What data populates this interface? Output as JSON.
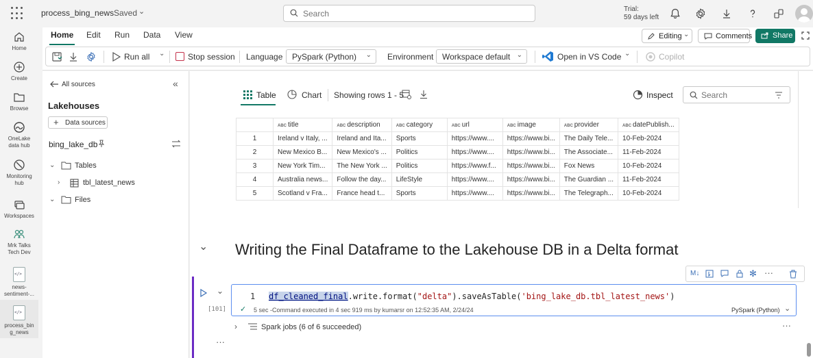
{
  "topbar": {
    "notebook_name": "process_bing_news",
    "save_state": "Saved",
    "search_placeholder": "Search",
    "trial_line1": "Trial:",
    "trial_line2": "59 days left"
  },
  "leftrail": {
    "items": [
      {
        "label": "Home",
        "icon": "home-icon"
      },
      {
        "label": "Create",
        "icon": "plus-circle-icon"
      },
      {
        "label": "Browse",
        "icon": "folder-icon"
      },
      {
        "label1": "OneLake",
        "label2": "data hub",
        "icon": "onelake-icon"
      },
      {
        "label1": "Monitoring",
        "label2": "hub",
        "icon": "monitor-icon"
      },
      {
        "label": "Workspaces",
        "icon": "workspaces-icon"
      },
      {
        "label1": "Mrk Talks",
        "label2": "Tech Dev",
        "icon": "workspace-people-icon"
      },
      {
        "label1": "news-",
        "label2": "sentiment-...",
        "icon": "notebook-icon"
      },
      {
        "label1": "process_bin",
        "label2": "g_news",
        "icon": "notebook-icon"
      }
    ]
  },
  "ribbon": {
    "tabs": [
      "Home",
      "Edit",
      "Run",
      "Data",
      "View"
    ],
    "editing": "Editing",
    "comments": "Comments",
    "share": "Share",
    "run_all": "Run all",
    "stop_session": "Stop session",
    "language_label": "Language",
    "language_value": "PySpark (Python)",
    "environment_label": "Environment",
    "environment_value": "Workspace default",
    "open_vscode": "Open in VS Code",
    "copilot": "Copilot"
  },
  "explorer": {
    "back_label": "All sources",
    "section_title": "Lakehouses",
    "data_sources_btn": "Data sources",
    "lakehouse_name": "bing_lake_db",
    "tables_label": "Tables",
    "table_item": "tbl_latest_news",
    "files_label": "Files"
  },
  "output": {
    "table_tab": "Table",
    "chart_tab": "Chart",
    "rows_info": "Showing rows 1 - 5",
    "inspect": "Inspect",
    "search_placeholder": "Search",
    "columns": [
      "title",
      "description",
      "category",
      "url",
      "image",
      "provider",
      "datePublish..."
    ],
    "rows": [
      [
        "1",
        "Ireland v Italy, ...",
        "Ireland and Ita...",
        "Sports",
        "https://www....",
        "https://www.bi...",
        "The Daily Tele...",
        "10-Feb-2024"
      ],
      [
        "2",
        "New Mexico B...",
        "New Mexico's ...",
        "Politics",
        "https://www....",
        "https://www.bi...",
        "The Associate...",
        "11-Feb-2024"
      ],
      [
        "3",
        "New York Tim...",
        "The New York ...",
        "Politics",
        "https://www.f...",
        "https://www.bi...",
        "Fox News",
        "10-Feb-2024"
      ],
      [
        "4",
        "Australia news...",
        "Follow the day...",
        "LifeStyle",
        "https://www....",
        "https://www.bi...",
        "The Guardian ...",
        "11-Feb-2024"
      ],
      [
        "5",
        "Scotland v Fra...",
        "France head t...",
        "Sports",
        "https://www....",
        "https://www.bi...",
        "The Telegraph...",
        "10-Feb-2024"
      ]
    ]
  },
  "markdown": {
    "heading": "Writing the Final Dataframe to the Lakehouse DB in a Delta format"
  },
  "cell": {
    "line_number": "1",
    "exec_count": "[101]",
    "code_var": "df_cleaned_final",
    "code_write": ".write.format(",
    "code_delta": "\"delta\"",
    "code_save": ").saveAsTable(",
    "code_table": "'bing_lake_db.tbl_latest_news'",
    "code_close": ")",
    "status": "5 sec -Command executed in 4 sec 919 ms by kumarsr on 12:52:35 AM, 2/24/24",
    "language": "PySpark (Python)",
    "spark_jobs": "Spark jobs (6 of 6 succeeded)"
  },
  "colors": {
    "accent": "#117865",
    "active_cell": "#6b2bc4",
    "cell_border": "#5b8def"
  }
}
